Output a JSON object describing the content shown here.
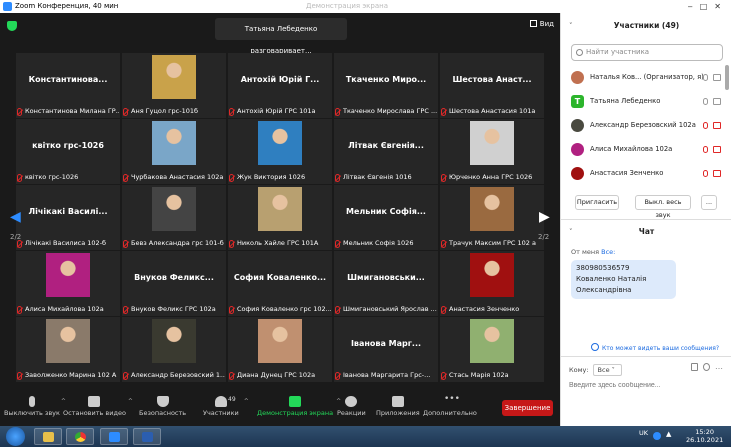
{
  "window": {
    "title": "Zoom Конференция, 40 мин",
    "bg_title": "Демонстрация экрана"
  },
  "top": {
    "speaking": "Татьяна Лебеденко разговаривает...",
    "view_label": "Вид"
  },
  "tiles": [
    {
      "name": "Константинова...",
      "label": "Константинова Милана ГР..."
    },
    {
      "name": "",
      "label": "Аня Гуцол грс-101б",
      "photo": "#c9a24a"
    },
    {
      "name": "Антохій Юрій Г...",
      "label": "Антохій Юрій ГРС 101а"
    },
    {
      "name": "Ткаченко Миро...",
      "label": "Ткаченко Мирослава ГРС ..."
    },
    {
      "name": "Шестова Анаст...",
      "label": "Шестова Анастасия 101а"
    },
    {
      "name": "квітко грс-1026",
      "label": "квітко грс-1026"
    },
    {
      "name": "",
      "label": "Чурбакова Анастасия 102а",
      "photo": "#7aa6c8"
    },
    {
      "name": "",
      "label": "Жук Виктория 1026",
      "photo": "#2f7fc0"
    },
    {
      "name": "Літвак Євгенія...",
      "label": "Літвак Євгенія 1016"
    },
    {
      "name": "",
      "label": "Юрченко Анна ГРС 1026",
      "photo": "#d0d0d0"
    },
    {
      "name": "Лічікакі Василі...",
      "label": "Лічікакі Василиса 102-б"
    },
    {
      "name": "",
      "label": "Бевз Александра грс 101-б",
      "photo": "#444444"
    },
    {
      "name": "",
      "label": "Николь Хайле ГРС 101А",
      "photo": "#b8a070"
    },
    {
      "name": "Мельник Софія...",
      "label": "Мельник Софія 1026"
    },
    {
      "name": "",
      "label": "Трачук Максим ГРС 102 а",
      "photo": "#9a6a40"
    },
    {
      "name": "",
      "label": "Алиса Михайлова 102а",
      "photo": "#b02080"
    },
    {
      "name": "Внуков Феликс...",
      "label": "Внуков Феликс ГРС 102а"
    },
    {
      "name": "София Коваленко...",
      "label": "София Коваленко грс 102..."
    },
    {
      "name": "Шмигановськи...",
      "label": "Шмигановський Ярослав ..."
    },
    {
      "name": "",
      "label": "Анастасия Зенченко",
      "photo": "#a01010"
    },
    {
      "name": "",
      "label": "Заволженко Марина 102 А",
      "photo": "#8a7a6a"
    },
    {
      "name": "",
      "label": "Александр Березовский 1...",
      "photo": "#3a3a30"
    },
    {
      "name": "",
      "label": "Диана Дунец ГРС 102а",
      "photo": "#c09070"
    },
    {
      "name": "Іванова Марг...",
      "label": "Іванова Маргарита Грс-..."
    },
    {
      "name": "",
      "label": "Стась Марія 102а",
      "photo": "#90b070"
    }
  ],
  "paging": {
    "left": "2/2",
    "right": "2/2"
  },
  "toolbar": {
    "mute": "Выключить звук",
    "video": "Остановить видео",
    "security": "Безопасность",
    "participants": "Участники",
    "participants_count": "49",
    "share": "Демонстрация экрана",
    "reactions": "Реакции",
    "apps": "Приложения",
    "more": "Дополнительно",
    "end": "Завершение"
  },
  "panel": {
    "title": "Участники (49)",
    "search_placeholder": "Найти участника",
    "participants": [
      {
        "name": "Наталья Ков... (Организатор, я)",
        "color": "#c07050"
      },
      {
        "name": "Татьяна Лебеденко",
        "initial": "Т",
        "color": "#2cb52c"
      },
      {
        "name": "Александр Березовский 102а",
        "color": "#4a4a40"
      },
      {
        "name": "Алиса Михайлова 102а",
        "color": "#b02080"
      },
      {
        "name": "Анастасия Зенченко",
        "color": "#a01010"
      }
    ],
    "invite": "Пригласить",
    "mute_all": "Выкл. весь звук",
    "more": "...",
    "chat_title": "Чат",
    "from_label": "От меня",
    "from_to": "Все:",
    "message": "380980536579 Коваленко Наталія Олександрівна",
    "who_can_see": "Кто может видеть ваши сообщения?",
    "to_label": "Кому:",
    "to_value": "Все",
    "input_placeholder": "Введите здесь сообщение..."
  },
  "taskbar": {
    "lang": "UK",
    "time": "15:20",
    "date": "26.10.2021"
  },
  "colors": {
    "accent": "#2d8cff",
    "end": "#c61818",
    "share": "#23d959",
    "muted": "#e02828"
  }
}
